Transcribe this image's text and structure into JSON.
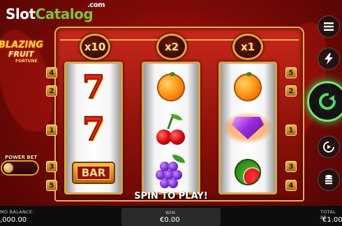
{
  "watermark": {
    "part1": "Slot",
    "part2": "Catalog",
    "suffix": ".com"
  },
  "game_logo": {
    "line1": "BLAZING",
    "line2": "FRUIT",
    "line3": "FORTUNE"
  },
  "multipliers": [
    "x10",
    "x2",
    "x1"
  ],
  "paylines": {
    "left": [
      "4",
      "2",
      "1",
      "3",
      "5"
    ],
    "right": [
      "5",
      "2",
      "1",
      "3",
      "4"
    ]
  },
  "reels": [
    [
      "seven",
      "seven",
      "bar"
    ],
    [
      "orange",
      "cherry",
      "grapes"
    ],
    [
      "orange",
      "diamond",
      "watermelon"
    ]
  ],
  "symbol_labels": {
    "seven": "7",
    "bar": "BAR"
  },
  "power_bet": {
    "label": "POWER BET"
  },
  "spin_prompt": "SPIN TO PLAY!",
  "side_buttons": [
    "menu-icon",
    "lightning-icon",
    "spin-icon",
    "autoplay-icon",
    "coin-stack-icon"
  ],
  "bottom_bar": {
    "balance_label": "MO BALANCE:",
    "balance_value": ",000.00",
    "win_label": "WIN",
    "win_value": "€0.00",
    "total_bet_label": "TOTAL BE",
    "total_bet_value": "€1.00"
  },
  "colors": {
    "accent": "#e8b04a",
    "background": "#8e1209",
    "spin_glow": "#2ee05a",
    "watermark_green": "#7cc243"
  }
}
